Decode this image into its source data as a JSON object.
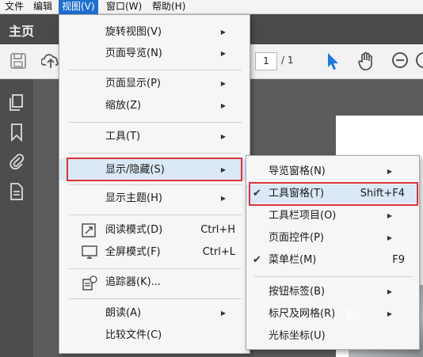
{
  "menubar": {
    "items": [
      "文件",
      "编辑",
      "视图(V)",
      "窗口(W)",
      "帮助(H)"
    ],
    "active_index": 2
  },
  "topbar": {
    "title": "主页"
  },
  "toolbar": {
    "page_current": "1",
    "page_total": "/ 1"
  },
  "view_menu": {
    "items": [
      {
        "label": "旋转视图(V)",
        "submenu": true
      },
      {
        "label": "页面导览(N)",
        "submenu": true
      },
      {
        "label": "页面显示(P)",
        "submenu": true
      },
      {
        "label": "缩放(Z)",
        "submenu": true
      },
      {
        "label": "工具(T)",
        "submenu": true
      },
      {
        "label": "显示/隐藏(S)",
        "submenu": true,
        "highlighted": true
      },
      {
        "label": "显示主题(H)",
        "submenu": true
      },
      {
        "label": "阅读模式(D)",
        "shortcut": "Ctrl+H",
        "icon": "read-mode-icon"
      },
      {
        "label": "全屏模式(F)",
        "shortcut": "Ctrl+L",
        "icon": "fullscreen-icon"
      },
      {
        "label": "追踪器(K)...",
        "icon": "tracker-icon"
      },
      {
        "label": "朗读(A)",
        "submenu": true
      },
      {
        "label": "比较文件(C)"
      }
    ]
  },
  "show_hide_menu": {
    "items": [
      {
        "label": "导览窗格(N)",
        "submenu": true
      },
      {
        "label": "工具窗格(T)",
        "shortcut": "Shift+F4",
        "checked": true,
        "highlighted": true
      },
      {
        "label": "工具栏项目(O)",
        "submenu": true
      },
      {
        "label": "页面控件(P)",
        "submenu": true
      },
      {
        "label": "菜单栏(M)",
        "shortcut": "F9",
        "checked": true
      },
      {
        "label": "按钮标签(B)",
        "submenu": true
      },
      {
        "label": "标尺及网格(R)",
        "submenu": true
      },
      {
        "label": "光标坐标(U)"
      }
    ]
  },
  "watermark": "Bai"
}
